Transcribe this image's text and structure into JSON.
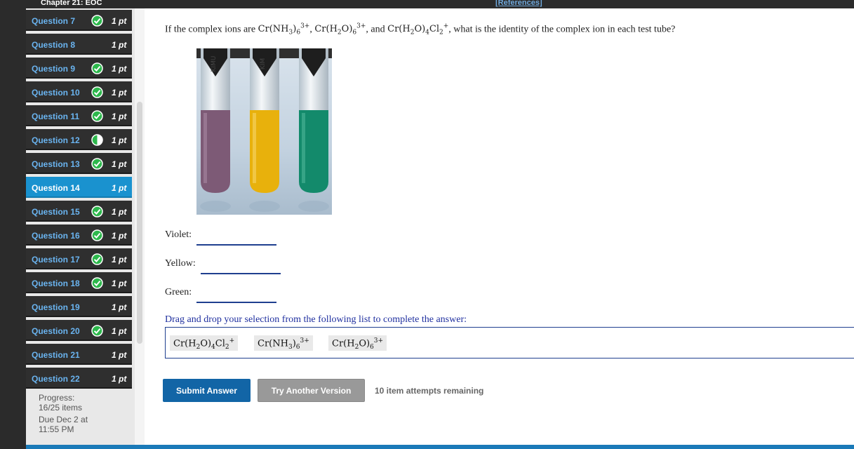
{
  "header": {
    "chapter_title": "Chapter 21: EOC",
    "references_label": "[References]"
  },
  "sidebar": {
    "questions": [
      {
        "label": "Question 7",
        "points": "1 pt",
        "status": "complete",
        "active": false
      },
      {
        "label": "Question 8",
        "points": "1 pt",
        "status": "none",
        "active": false
      },
      {
        "label": "Question 9",
        "points": "1 pt",
        "status": "complete",
        "active": false
      },
      {
        "label": "Question 10",
        "points": "1 pt",
        "status": "complete",
        "active": false
      },
      {
        "label": "Question 11",
        "points": "1 pt",
        "status": "complete",
        "active": false
      },
      {
        "label": "Question 12",
        "points": "1 pt",
        "status": "partial",
        "active": false
      },
      {
        "label": "Question 13",
        "points": "1 pt",
        "status": "complete",
        "active": false
      },
      {
        "label": "Question 14",
        "points": "1 pt",
        "status": "none",
        "active": true
      },
      {
        "label": "Question 15",
        "points": "1 pt",
        "status": "complete",
        "active": false
      },
      {
        "label": "Question 16",
        "points": "1 pt",
        "status": "complete",
        "active": false
      },
      {
        "label": "Question 17",
        "points": "1 pt",
        "status": "complete",
        "active": false
      },
      {
        "label": "Question 18",
        "points": "1 pt",
        "status": "complete",
        "active": false
      },
      {
        "label": "Question 19",
        "points": "1 pt",
        "status": "none",
        "active": false
      },
      {
        "label": "Question 20",
        "points": "1 pt",
        "status": "complete",
        "active": false
      },
      {
        "label": "Question 21",
        "points": "1 pt",
        "status": "none",
        "active": false
      },
      {
        "label": "Question 22",
        "points": "1 pt",
        "status": "none",
        "active": false
      }
    ],
    "progress_label": "Progress:",
    "progress_value": "16/25 items",
    "due_label": "Due Dec 2 at",
    "due_time": "11:55 PM"
  },
  "question": {
    "prefix": "If the complex ions are ",
    "ion1": {
      "pre": "Cr(NH",
      "sub1": "3",
      "mid": ")",
      "sub2": "6",
      "sup": "3+"
    },
    "sep1": ", ",
    "ion2": {
      "pre": "Cr(H",
      "sub1": "2",
      "mid": "O)",
      "sub2": "6",
      "sup": "3+"
    },
    "sep2": ", and ",
    "ion3": {
      "pre": "Cr(H",
      "sub1": "2",
      "mid": "O)",
      "sub2": "4",
      "mid2": "Cl",
      "sub3": "2",
      "sup": "+"
    },
    "suffix": ", what is the identity of the complex ion in each test tube?"
  },
  "answers": {
    "violet_label": "Violet:",
    "yellow_label": "Yellow:",
    "green_label": "Green:"
  },
  "instruction": "Drag and drop your selection from the following list to complete the answer:",
  "chips": {
    "chip1": {
      "pre": "Cr(H",
      "sub1": "2",
      "mid": "O)",
      "sub2": "4",
      "mid2": "Cl",
      "sub3": "2",
      "sup": "+"
    },
    "chip2": {
      "pre": "Cr(NH",
      "sub1": "3",
      "mid": ")",
      "sub2": "6",
      "sup": "3+"
    },
    "chip3": {
      "pre": "Cr(H",
      "sub1": "2",
      "mid": "O)",
      "sub2": "6",
      "sup": "3+"
    }
  },
  "buttons": {
    "submit": "Submit Answer",
    "try_another": "Try Another Version"
  },
  "attempts": "10 item attempts remaining",
  "colors": {
    "active_question": "#1a92cf",
    "link_blue": "#6ab4f0",
    "check_green": "#2db84c",
    "submit_blue": "#1265a6",
    "tube_violet": "#7d5a76",
    "tube_yellow": "#e8b10c",
    "tube_green": "#138a6b"
  }
}
